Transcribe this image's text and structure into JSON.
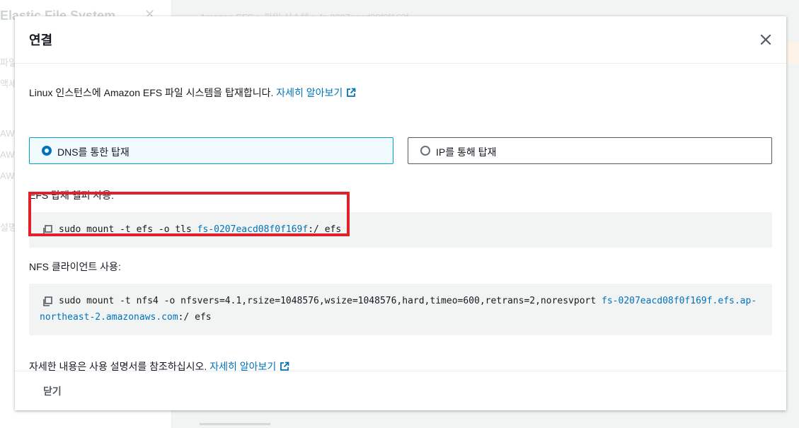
{
  "background": {
    "sidebar_title": "Elastic File System",
    "sidebar_items": [
      "파일",
      "액세",
      "AWS",
      "AWS",
      "AWS",
      "설명"
    ],
    "breadcrumb": "Amazon EFS  >  파일 시스템  >  fs-0207eacd08f0f169f"
  },
  "modal": {
    "title": "연결",
    "intro_text": "Linux 인스턴스에 Amazon EFS 파일 시스템을 탑재합니다.",
    "intro_link": "자세히 알아보기",
    "radio_dns_label": "DNS를 통한 탑재",
    "radio_ip_label": "IP를 통해 탑재",
    "efs_helper_label": "EFS 탑재 헬퍼 사용:",
    "efs_cmd_prefix": "sudo mount -t efs -o tls ",
    "efs_cmd_link": "fs-0207eacd08f0f169f",
    "efs_cmd_suffix": ":/ efs",
    "nfs_label": "NFS 클라이언트 사용:",
    "nfs_cmd_prefix": "sudo mount -t nfs4 -o nfsvers=4.1,rsize=1048576,wsize=1048576,hard,timeo=600,retrans=2,noresvport ",
    "nfs_cmd_link_1": "fs-0207eacd08f0f169f.efs.ap-",
    "nfs_cmd_link_2": "northeast-2.amazonaws.com",
    "nfs_cmd_suffix": ":/ efs",
    "footer_note_text": "자세한 내용은 사용 설명서를 참조하십시오.",
    "footer_note_link": "자세히 알아보기",
    "close_button": "닫기"
  },
  "colors": {
    "link": "#0073bb",
    "selected_border": "#00a1c9",
    "highlight": "#e0202a"
  }
}
